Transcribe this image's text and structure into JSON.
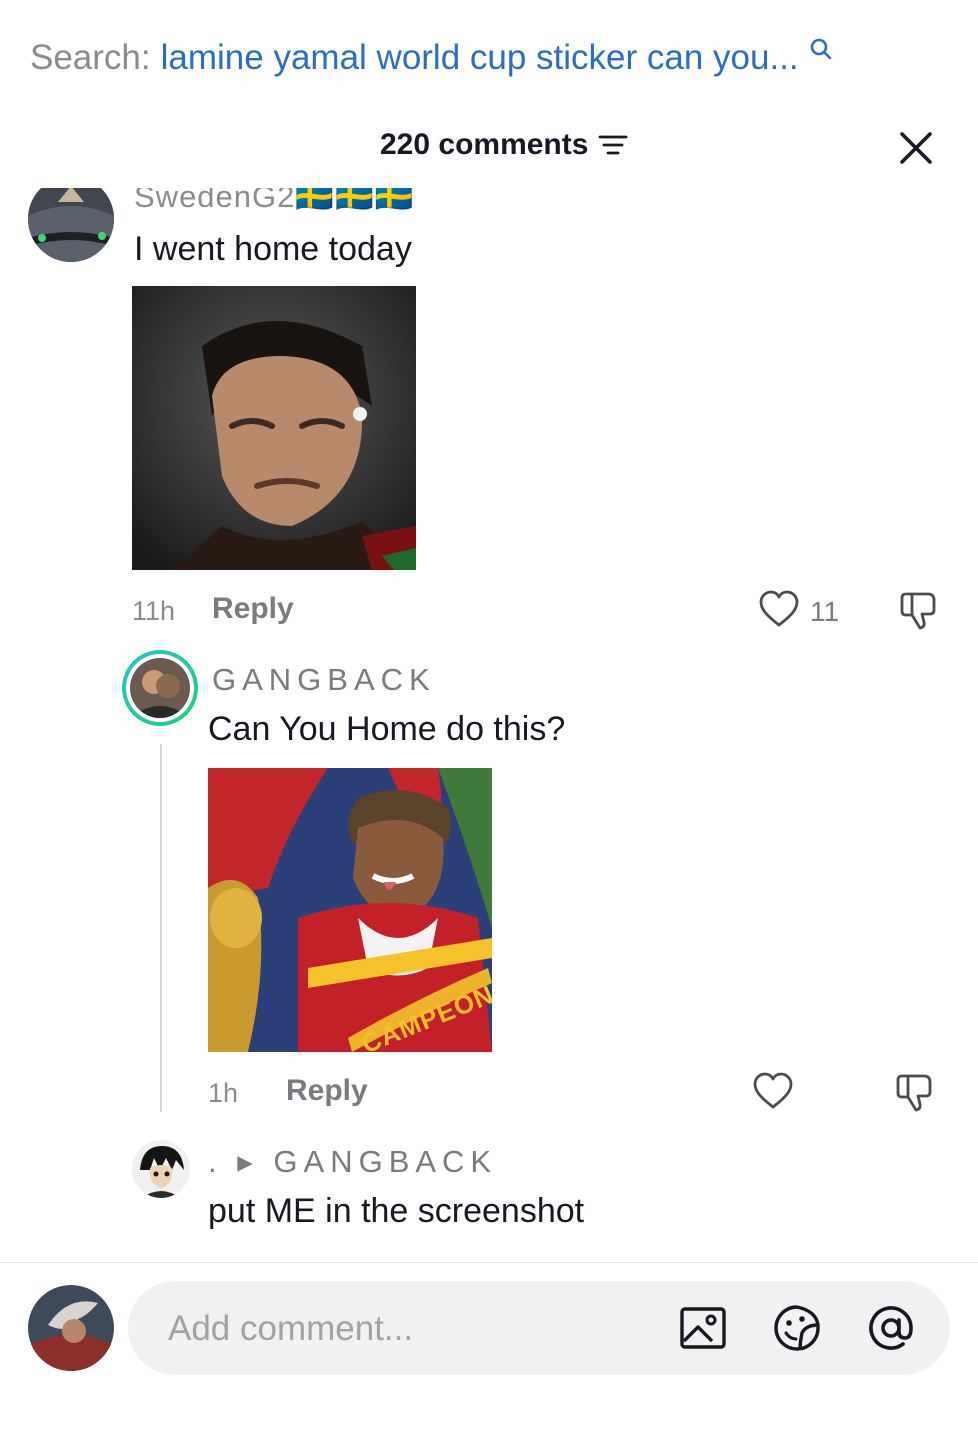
{
  "search": {
    "prefix": "Search:",
    "query": "lamine yamal world cup sticker can you...",
    "icon": "search-icon"
  },
  "header": {
    "count": "220 comments",
    "filter_icon": "sort-icon",
    "close_icon": "close-icon"
  },
  "comments": [
    {
      "username": "SwedenG2🇸🇪🇸🇪🇸🇪",
      "text": "I went home today",
      "time": "11h",
      "reply": "Reply",
      "likes": "11",
      "media": "sticker-image"
    },
    {
      "username": "GANGBACK",
      "text": "Can You Home do this?",
      "time": "1h",
      "reply": "Reply",
      "likes": "",
      "media": "sticker-image",
      "media_caption": "CAMPEON"
    },
    {
      "username": ". ▸ GANGBACK",
      "text": "put ME in the screenshot"
    }
  ],
  "composer": {
    "placeholder": "Add comment...",
    "image_icon": "image-icon",
    "emoji_icon": "sticker-icon",
    "mention_icon": "mention-icon"
  },
  "colors": {
    "query_blue": "#2a6dc6",
    "text_dark": "#161823",
    "muted": "#8a8b91",
    "story_ring_a": "#1ec7d6",
    "story_ring_b": "#21d07a"
  }
}
